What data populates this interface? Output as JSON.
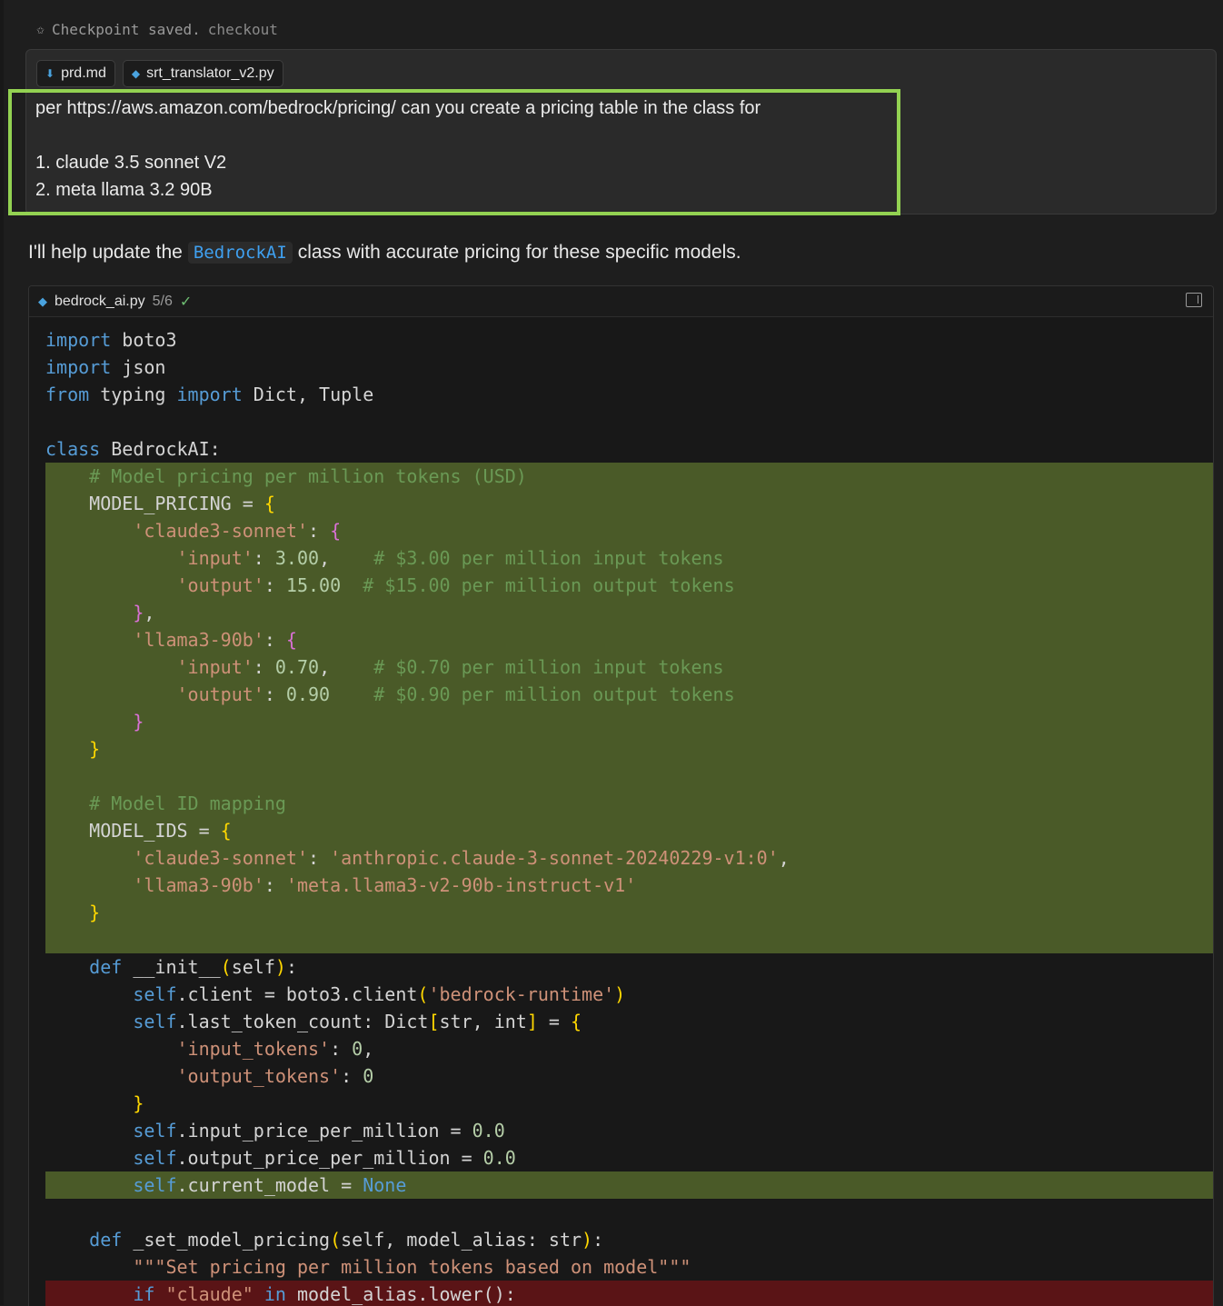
{
  "checkpoint": {
    "text": "Checkpoint saved.",
    "link": "checkout"
  },
  "attachments": [
    "prd.md",
    "srt_translator_v2.py"
  ],
  "prompt": {
    "line1": "per https://aws.amazon.com/bedrock/pricing/ can you create a pricing table in the class for",
    "line2": "",
    "line3": "1. claude 3.5 sonnet V2",
    "line4": "2. meta llama 3.2 90B"
  },
  "assistant": {
    "before": "I'll help update the",
    "code": "BedrockAI",
    "after": "class with accurate pricing for these specific models."
  },
  "codeblock": {
    "filename": "bedrock_ai.py",
    "count": "5/6",
    "check": "✓",
    "lines": [
      {
        "t": "",
        "h": [
          [
            "kw",
            "import"
          ],
          [
            "var",
            " boto3"
          ]
        ]
      },
      {
        "t": "",
        "h": [
          [
            "kw",
            "import"
          ],
          [
            "var",
            " json"
          ]
        ]
      },
      {
        "t": "",
        "h": [
          [
            "kw",
            "from"
          ],
          [
            "var",
            " typing "
          ],
          [
            "kw",
            "import"
          ],
          [
            "var",
            " Dict, Tuple"
          ]
        ]
      },
      {
        "t": "",
        "h": []
      },
      {
        "t": "",
        "h": [
          [
            "kw",
            "class"
          ],
          [
            "var",
            " BedrockAI:"
          ]
        ]
      },
      {
        "t": "add",
        "h": [
          [
            "var",
            "    "
          ],
          [
            "cmt",
            "# Model pricing per million tokens (USD)"
          ]
        ]
      },
      {
        "t": "add",
        "h": [
          [
            "var",
            "    MODEL_PRICING = "
          ],
          [
            "b1",
            "{"
          ]
        ]
      },
      {
        "t": "add",
        "h": [
          [
            "var",
            "        "
          ],
          [
            "str",
            "'claude3-sonnet'"
          ],
          [
            "var",
            ": "
          ],
          [
            "b2",
            "{"
          ]
        ]
      },
      {
        "t": "add",
        "h": [
          [
            "var",
            "            "
          ],
          [
            "str",
            "'input'"
          ],
          [
            "var",
            ": "
          ],
          [
            "num",
            "3.00"
          ],
          [
            "var",
            ",    "
          ],
          [
            "cmt",
            "# $3.00 per million input tokens"
          ]
        ]
      },
      {
        "t": "add",
        "h": [
          [
            "var",
            "            "
          ],
          [
            "str",
            "'output'"
          ],
          [
            "var",
            ": "
          ],
          [
            "num",
            "15.00"
          ],
          [
            "var",
            "  "
          ],
          [
            "cmt",
            "# $15.00 per million output tokens"
          ]
        ]
      },
      {
        "t": "add",
        "h": [
          [
            "var",
            "        "
          ],
          [
            "b2",
            "}"
          ],
          [
            "var",
            ","
          ]
        ]
      },
      {
        "t": "add",
        "h": [
          [
            "var",
            "        "
          ],
          [
            "str",
            "'llama3-90b'"
          ],
          [
            "var",
            ": "
          ],
          [
            "b2",
            "{"
          ]
        ]
      },
      {
        "t": "add",
        "h": [
          [
            "var",
            "            "
          ],
          [
            "str",
            "'input'"
          ],
          [
            "var",
            ": "
          ],
          [
            "num",
            "0.70"
          ],
          [
            "var",
            ",    "
          ],
          [
            "cmt",
            "# $0.70 per million input tokens"
          ]
        ]
      },
      {
        "t": "add",
        "h": [
          [
            "var",
            "            "
          ],
          [
            "str",
            "'output'"
          ],
          [
            "var",
            ": "
          ],
          [
            "num",
            "0.90"
          ],
          [
            "var",
            "    "
          ],
          [
            "cmt",
            "# $0.90 per million output tokens"
          ]
        ]
      },
      {
        "t": "add",
        "h": [
          [
            "var",
            "        "
          ],
          [
            "b2",
            "}"
          ]
        ]
      },
      {
        "t": "add",
        "h": [
          [
            "var",
            "    "
          ],
          [
            "b1",
            "}"
          ]
        ]
      },
      {
        "t": "add",
        "h": []
      },
      {
        "t": "add",
        "h": [
          [
            "var",
            "    "
          ],
          [
            "cmt",
            "# Model ID mapping"
          ]
        ]
      },
      {
        "t": "add",
        "h": [
          [
            "var",
            "    MODEL_IDS = "
          ],
          [
            "b1",
            "{"
          ]
        ]
      },
      {
        "t": "add",
        "h": [
          [
            "var",
            "        "
          ],
          [
            "str",
            "'claude3-sonnet'"
          ],
          [
            "var",
            ": "
          ],
          [
            "str",
            "'anthropic.claude-3-sonnet-20240229-v1:0'"
          ],
          [
            "var",
            ","
          ]
        ]
      },
      {
        "t": "add",
        "h": [
          [
            "var",
            "        "
          ],
          [
            "str",
            "'llama3-90b'"
          ],
          [
            "var",
            ": "
          ],
          [
            "str",
            "'meta.llama3-v2-90b-instruct-v1'"
          ]
        ]
      },
      {
        "t": "add",
        "h": [
          [
            "var",
            "    "
          ],
          [
            "b1",
            "}"
          ]
        ]
      },
      {
        "t": "add",
        "h": []
      },
      {
        "t": "",
        "h": [
          [
            "var",
            "    "
          ],
          [
            "kw",
            "def"
          ],
          [
            "var",
            " __init__"
          ],
          [
            "b1",
            "("
          ],
          [
            "var",
            "self"
          ],
          [
            "b1",
            ")"
          ],
          [
            "var",
            ":"
          ]
        ]
      },
      {
        "t": "",
        "h": [
          [
            "var",
            "        "
          ],
          [
            "kw",
            "self"
          ],
          [
            "var",
            ".client = boto3.client"
          ],
          [
            "b1",
            "("
          ],
          [
            "str",
            "'bedrock-runtime'"
          ],
          [
            "b1",
            ")"
          ]
        ]
      },
      {
        "t": "",
        "h": [
          [
            "var",
            "        "
          ],
          [
            "kw",
            "self"
          ],
          [
            "var",
            ".last_token_count: Dict"
          ],
          [
            "b1",
            "["
          ],
          [
            "var",
            "str, int"
          ],
          [
            "b1",
            "]"
          ],
          [
            "var",
            " = "
          ],
          [
            "b1",
            "{"
          ]
        ]
      },
      {
        "t": "",
        "h": [
          [
            "var",
            "            "
          ],
          [
            "str",
            "'input_tokens'"
          ],
          [
            "var",
            ": "
          ],
          [
            "num",
            "0"
          ],
          [
            "var",
            ","
          ]
        ]
      },
      {
        "t": "",
        "h": [
          [
            "var",
            "            "
          ],
          [
            "str",
            "'output_tokens'"
          ],
          [
            "var",
            ": "
          ],
          [
            "num",
            "0"
          ]
        ]
      },
      {
        "t": "",
        "h": [
          [
            "var",
            "        "
          ],
          [
            "b1",
            "}"
          ]
        ]
      },
      {
        "t": "",
        "h": [
          [
            "var",
            "        "
          ],
          [
            "kw",
            "self"
          ],
          [
            "var",
            ".input_price_per_million = "
          ],
          [
            "num",
            "0.0"
          ]
        ]
      },
      {
        "t": "",
        "h": [
          [
            "var",
            "        "
          ],
          [
            "kw",
            "self"
          ],
          [
            "var",
            ".output_price_per_million = "
          ],
          [
            "num",
            "0.0"
          ]
        ]
      },
      {
        "t": "add",
        "h": [
          [
            "var",
            "        "
          ],
          [
            "kw",
            "self"
          ],
          [
            "var",
            ".current_model = "
          ],
          [
            "kw",
            "None"
          ]
        ]
      },
      {
        "t": "",
        "h": []
      },
      {
        "t": "",
        "h": [
          [
            "var",
            "    "
          ],
          [
            "kw",
            "def"
          ],
          [
            "var",
            " _set_model_pricing"
          ],
          [
            "b1",
            "("
          ],
          [
            "var",
            "self, model_alias: str"
          ],
          [
            "b1",
            ")"
          ],
          [
            "var",
            ":"
          ]
        ]
      },
      {
        "t": "",
        "h": [
          [
            "var",
            "        "
          ],
          [
            "str",
            "\"\"\"Set pricing per million tokens based on model\"\"\""
          ]
        ]
      },
      {
        "t": "del",
        "h": [
          [
            "var",
            "        "
          ],
          [
            "kw",
            "if"
          ],
          [
            "var",
            " "
          ],
          [
            "str",
            "\"claude\""
          ],
          [
            "var",
            " "
          ],
          [
            "kw",
            "in"
          ],
          [
            "var",
            " model_alias.lower():"
          ]
        ]
      }
    ]
  },
  "colors": {
    "added_bg": "#4a5a28",
    "removed_bg": "#5a1416",
    "highlight_border": "#93d252",
    "keyword": "#569cd6",
    "string": "#ce9178",
    "comment": "#6a9955"
  }
}
